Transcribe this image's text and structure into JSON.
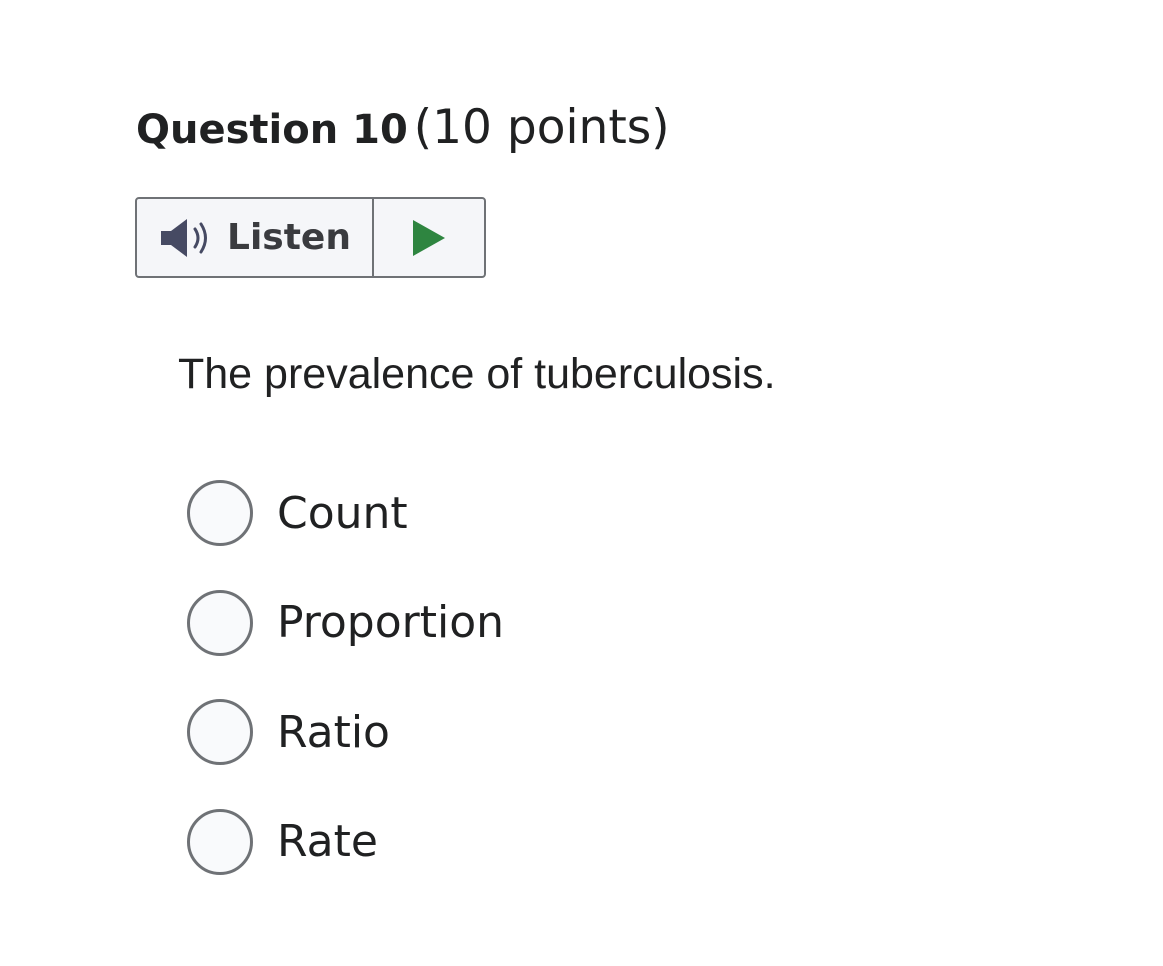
{
  "question": {
    "title": "Question 10",
    "points": "(10 points)",
    "prompt": "The prevalence of tuberculosis."
  },
  "listen": {
    "label": "Listen",
    "speaker_icon": "speaker-icon",
    "play_icon": "play-icon",
    "play_color": "#2e8540"
  },
  "options": [
    {
      "label": "Count",
      "selected": false
    },
    {
      "label": "Proportion",
      "selected": false
    },
    {
      "label": "Ratio",
      "selected": false
    },
    {
      "label": "Rate",
      "selected": false
    }
  ]
}
